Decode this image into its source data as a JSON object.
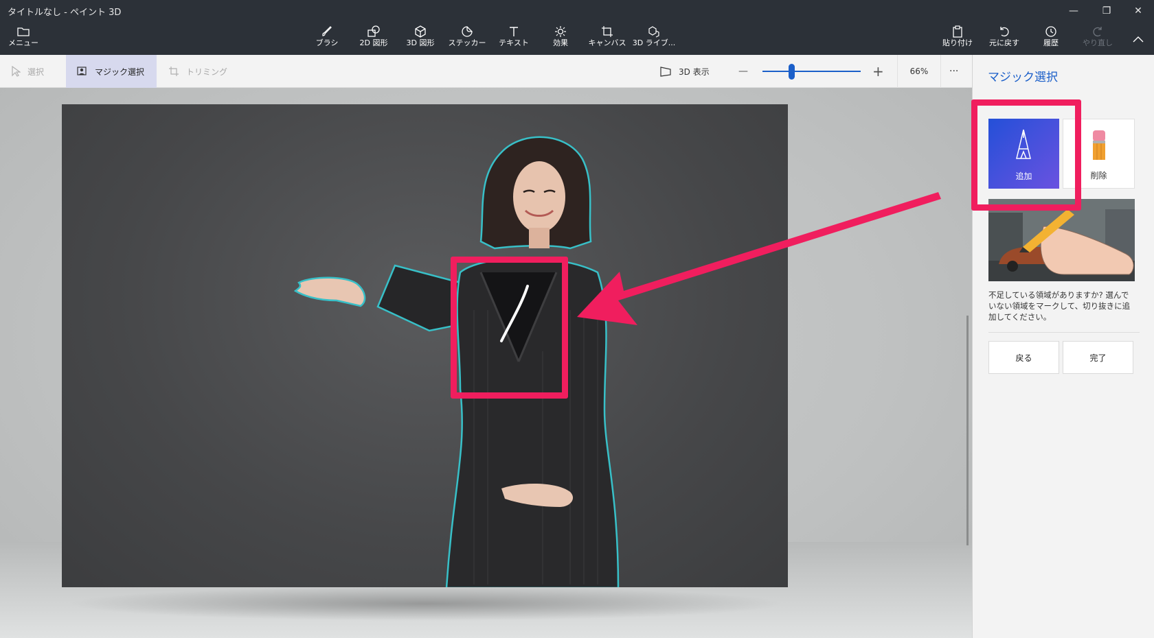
{
  "window": {
    "title": "タイトルなし - ペイント 3D"
  },
  "ribbon": {
    "menu": "メニュー",
    "tools": [
      {
        "label": "ブラシ",
        "icon": "brush-icon"
      },
      {
        "label": "2D 図形",
        "icon": "shapes-2d-icon"
      },
      {
        "label": "3D 図形",
        "icon": "shapes-3d-icon"
      },
      {
        "label": "ステッカー",
        "icon": "sticker-icon"
      },
      {
        "label": "テキスト",
        "icon": "text-icon"
      },
      {
        "label": "効果",
        "icon": "effects-icon"
      },
      {
        "label": "キャンバス",
        "icon": "canvas-icon"
      },
      {
        "label": "3D ライブ...",
        "icon": "3d-library-icon"
      }
    ],
    "paste": "貼り付け",
    "undo": "元に戻す",
    "history": "履歴",
    "redo": "やり直し"
  },
  "toolbar": {
    "select": "選択",
    "magic_select": "マジック選択",
    "crop": "トリミング",
    "view_3d": "3D 表示",
    "zoom_minus": "—",
    "zoom_plus": "+",
    "zoom": "66%",
    "zoom_level": 0.3,
    "more": "···"
  },
  "panel": {
    "title": "マジック選択",
    "add": "追加",
    "remove": "削除",
    "hint": "不足している領域がありますか? 選んでいない領域をマークして、切り抜きに追加してください。",
    "back": "戻る",
    "done": "完了"
  },
  "colors": {
    "accent": "#1b5fc9",
    "highlight": "#f01e5e",
    "selection_outline": "#38c0c8"
  }
}
